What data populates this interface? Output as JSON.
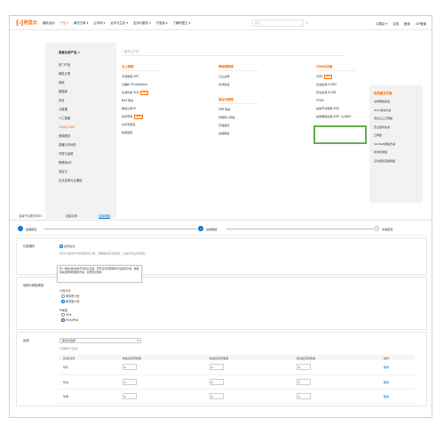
{
  "nav": {
    "logo_mark": "[-]",
    "logo_text": "阿里云",
    "items": [
      "最新活动",
      "产品 ▾",
      "解决方案 ▾",
      "云市场 ▾",
      "合作与生态 ▾",
      "支持与服务 ▾",
      "开发者 ▾",
      "了解阿里云 ▾"
    ],
    "search_placeholder": "搜索",
    "right_items": [
      "中国站 ▾",
      "文档",
      "备案",
      "ICP备案"
    ]
  },
  "dropdown": {
    "side_title": "查看全部产品 >",
    "side_items": [
      "热门产品",
      "弹性计算",
      "网络",
      "数据库",
      "安全",
      "大数据",
      "人工智能",
      "CDN与CDN",
      "视频服务",
      "容器与中间件",
      "开发与运维",
      "物联网IoT",
      "混合云",
      "企业应用与云通信"
    ],
    "search_placeholder": "搜索云产品",
    "columns": [
      {
        "header": "云上网络",
        "items": [
          {
            "label": "专有网络 VPC"
          },
          {
            "label": "云解析 PrivateZone"
          },
          {
            "label": "负载均衡 SLB",
            "badge": "HOT"
          },
          {
            "label": "NAT 网关"
          },
          {
            "label": "弹性公网 IP"
          },
          {
            "label": "共享带宽",
            "badge": "NEW"
          },
          {
            "label": "共享流量包"
          },
          {
            "label": "私网连接"
          }
        ]
      },
      {
        "header": "跨地域网络",
        "items": [
          {
            "label": "云企业网"
          },
          {
            "label": "全球加速"
          }
        ],
        "header2": "混合云网络",
        "items2": [
          {
            "label": "VPN 网关"
          },
          {
            "label": "智能接入网关"
          },
          {
            "label": "高速通道"
          },
          {
            "label": "边缘网络"
          }
        ]
      },
      {
        "header": "CDN与边缘",
        "items": [
          {
            "label": "CDN",
            "badge": "HOT"
          },
          {
            "label": "全站加速 DCDN"
          },
          {
            "label": "安全加速 SCDN"
          },
          {
            "label": "PCDN"
          },
          {
            "label": "边缘节点服务 ENS"
          },
          {
            "label": "边缘网络加速 ENR（公测中）"
          }
        ]
      }
    ],
    "recommend": {
      "header": "相关解决方案",
      "items": [
        "全球网络加速",
        "IPv6 解决方案",
        "混合云上云网络",
        "安全组件集成",
        "云网络",
        "SD-WAN网络方案",
        "新零售网络",
        "互动视频直播网络"
      ]
    }
  },
  "console": {
    "tabs": [
      "边缘节点服务ENS",
      "创建实例",
      "边缘网络"
    ],
    "steps": [
      "基础配置",
      "边缘网络",
      "系统配置"
    ],
    "pay": {
      "label": "付费模式",
      "option": "包年包月",
      "note": "包月计费的ENS实例按月计费，到期前请及时续费，以免影响业务使用。"
    },
    "network": {
      "label": "地域与网络规划",
      "tooltip": "同一地区内的边缘节点默认互通，若节点间需要隔离可设置安全组，跨区域请选择网络规划方案，实现安全隔离",
      "group1": "计费方式",
      "g1_opts": [
        "按带宽计费",
        "按流量计费"
      ],
      "group2": "IP类型",
      "g2_opts": [
        "IPv4",
        "IPv4/IPv6"
      ]
    },
    "region": {
      "label": "区域",
      "select": "按省份选择",
      "hint": "已选择0个区域",
      "columns": [
        "区域/省份",
        "电信运营商数量",
        "联通运营商数量",
        "移动运营商数量",
        "操作"
      ],
      "rows": [
        {
          "name": "华东",
          "c1": "0",
          "c2": "0",
          "c3": "0",
          "action": "删除"
        },
        {
          "name": "华北",
          "c1": "0",
          "c2": "0",
          "c3": "0",
          "action": "删除"
        },
        {
          "name": "华南",
          "c1": "0",
          "c2": "0",
          "c3": "0",
          "action": "删除"
        }
      ]
    }
  }
}
